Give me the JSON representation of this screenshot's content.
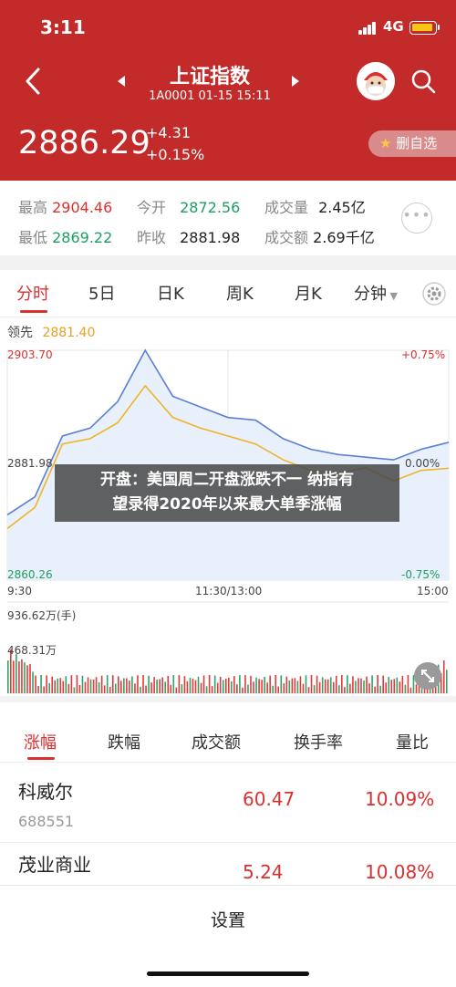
{
  "status": {
    "time": "3:11",
    "network": "4G"
  },
  "header": {
    "title": "上证指数",
    "subtitle": "1A0001   01-15 15:11",
    "price": "2886.29",
    "change_abs": "+4.31",
    "change_pct": "+0.15%",
    "watch_label": "删自选",
    "icons": [
      "back-icon",
      "prev-icon",
      "next-icon",
      "mascot-icon",
      "search-icon",
      "star-icon"
    ]
  },
  "stats": {
    "high_label": "最高",
    "high_value": "2904.46",
    "open_label": "今开",
    "open_value": "2872.56",
    "volume_label": "成交量",
    "volume_value": "2.45亿",
    "low_label": "最低",
    "low_value": "2869.22",
    "prev_close_label": "昨收",
    "prev_close_value": "2881.98",
    "amount_label": "成交额",
    "amount_value": "2.69千亿"
  },
  "tabs": {
    "items": [
      "分时",
      "5日",
      "日K",
      "周K",
      "月K",
      "分钟"
    ],
    "active": "分时"
  },
  "chart": {
    "lead_label": "领先",
    "lead_value": "2881.40",
    "y_top": "2903.70",
    "y_mid": "2881.98",
    "y_bottom": "2860.26",
    "pct_top": "+0.75%",
    "pct_mid": "0.00%",
    "pct_bottom": "-0.75%",
    "time_start": "9:30",
    "time_mid": "11:30/13:00",
    "time_end": "15:00",
    "vol_top": "936.62万(手)",
    "vol_mid": "468.31万",
    "colors": {
      "price": "#5b7fd6",
      "lead": "#f0b429",
      "fill": "#e8f0fb",
      "up": "#e03a3a",
      "down": "#2ea36a"
    }
  },
  "chart_data": {
    "type": "line",
    "title": "",
    "xlabel": "",
    "ylabel": "",
    "x": [
      "9:30",
      "9:45",
      "10:00",
      "10:15",
      "10:30",
      "10:45",
      "11:00",
      "11:15",
      "11:30/13:00",
      "13:15",
      "13:30",
      "13:45",
      "14:00",
      "14:15",
      "14:30",
      "14:45",
      "15:00"
    ],
    "series": [
      {
        "values": [
          2872.6,
          2876.0,
          2887.5,
          2889.0,
          2894.0,
          2903.7,
          2895.0,
          2893.0,
          2891.0,
          2890.5,
          2887.0,
          2885.0,
          2884.0,
          2883.5,
          2883.0,
          2885.0,
          2886.3
        ]
      },
      {
        "values": [
          2870.0,
          2874.0,
          2886.0,
          2887.0,
          2890.0,
          2897.0,
          2891.0,
          2889.0,
          2887.5,
          2886.0,
          2883.0,
          2881.0,
          2880.5,
          2881.5,
          2879.0,
          2881.0,
          2881.4
        ]
      }
    ],
    "ylim": [
      2860.26,
      2903.7
    ],
    "grid": true
  },
  "banner": {
    "line1": "开盘：美国周二开盘涨跌不一 纳指有",
    "line2": "望录得2020年以来最大单季涨幅"
  },
  "rank_tabs": {
    "items": [
      "涨幅",
      "跌幅",
      "成交额",
      "换手率",
      "量比"
    ],
    "active": "涨幅"
  },
  "stocks": [
    {
      "name": "科威尔",
      "code": "688551",
      "price": "60.47",
      "pct": "10.09%"
    },
    {
      "name": "茂业商业",
      "code": "",
      "price": "5.24",
      "pct": "10.08%"
    }
  ],
  "sheet": {
    "title": "设置"
  }
}
